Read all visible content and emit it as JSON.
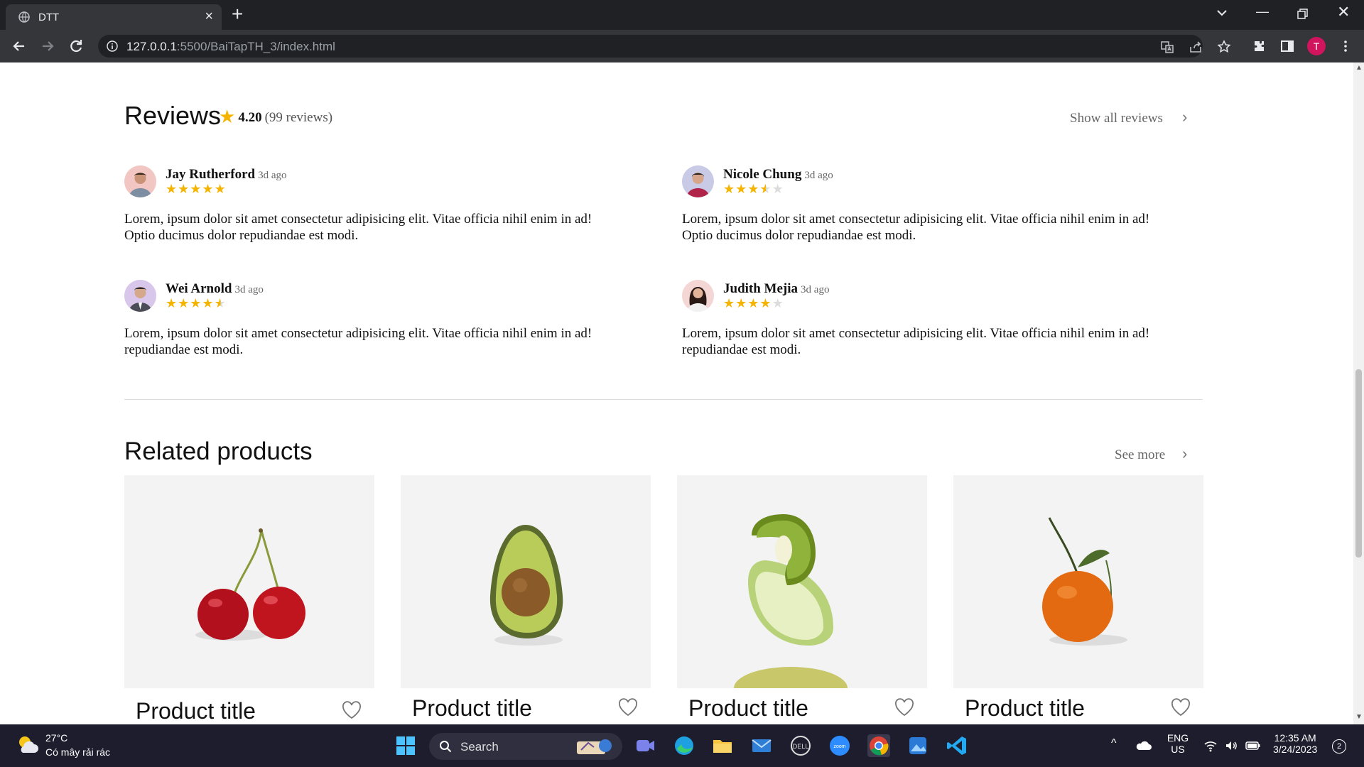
{
  "browser": {
    "tab_title": "DTT",
    "url_host": "127.0.0.1",
    "url_rest": ":5500/BaiTapTH_3/index.html",
    "profile_initial": "T"
  },
  "reviews": {
    "heading": "Reviews",
    "average": "4.20",
    "count_text": "(99 reviews)",
    "show_all_label": "Show all reviews",
    "items": [
      {
        "name": "Jay Rutherford",
        "ago": "3d ago",
        "rating": 5,
        "text": "Lorem, ipsum dolor sit amet consectetur adipisicing elit. Vitae officia nihil enim in ad! Optio ducimus dolor repudiandae est modi."
      },
      {
        "name": "Nicole Chung",
        "ago": "3d ago",
        "rating": 3.5,
        "text": "Lorem, ipsum dolor sit amet consectetur adipisicing elit. Vitae officia nihil enim in ad! Optio ducimus dolor repudiandae est modi."
      },
      {
        "name": "Wei Arnold",
        "ago": "3d ago",
        "rating": 4.5,
        "text": "Lorem, ipsum dolor sit amet consectetur adipisicing elit. Vitae officia nihil enim in ad! repudiandae est modi."
      },
      {
        "name": "Judith Mejia",
        "ago": "3d ago",
        "rating": 4,
        "text": "Lorem, ipsum dolor sit amet consectetur adipisicing elit. Vitae officia nihil enim in ad! repudiandae est modi."
      }
    ]
  },
  "related": {
    "heading": "Related products",
    "see_more_label": "See more",
    "products": [
      {
        "title": "Product title",
        "image": "cherry"
      },
      {
        "title": "Product title",
        "image": "avocado"
      },
      {
        "title": "Product title",
        "image": "kiwi-lime-pear"
      },
      {
        "title": "Product title",
        "image": "tangerine"
      }
    ]
  },
  "taskbar": {
    "weather_temp": "27°C",
    "weather_desc": "Có mây rải rác",
    "search_label": "Search",
    "lang_top": "ENG",
    "lang_bottom": "US",
    "time": "12:35 AM",
    "date": "3/24/2023",
    "notifications": "2"
  },
  "colors": {
    "star": "#f5b400",
    "star_empty": "#dcdcdc",
    "chrome_dark": "#202124",
    "chrome_toolbar": "#35363a",
    "taskbar": "#1d1d2e"
  }
}
